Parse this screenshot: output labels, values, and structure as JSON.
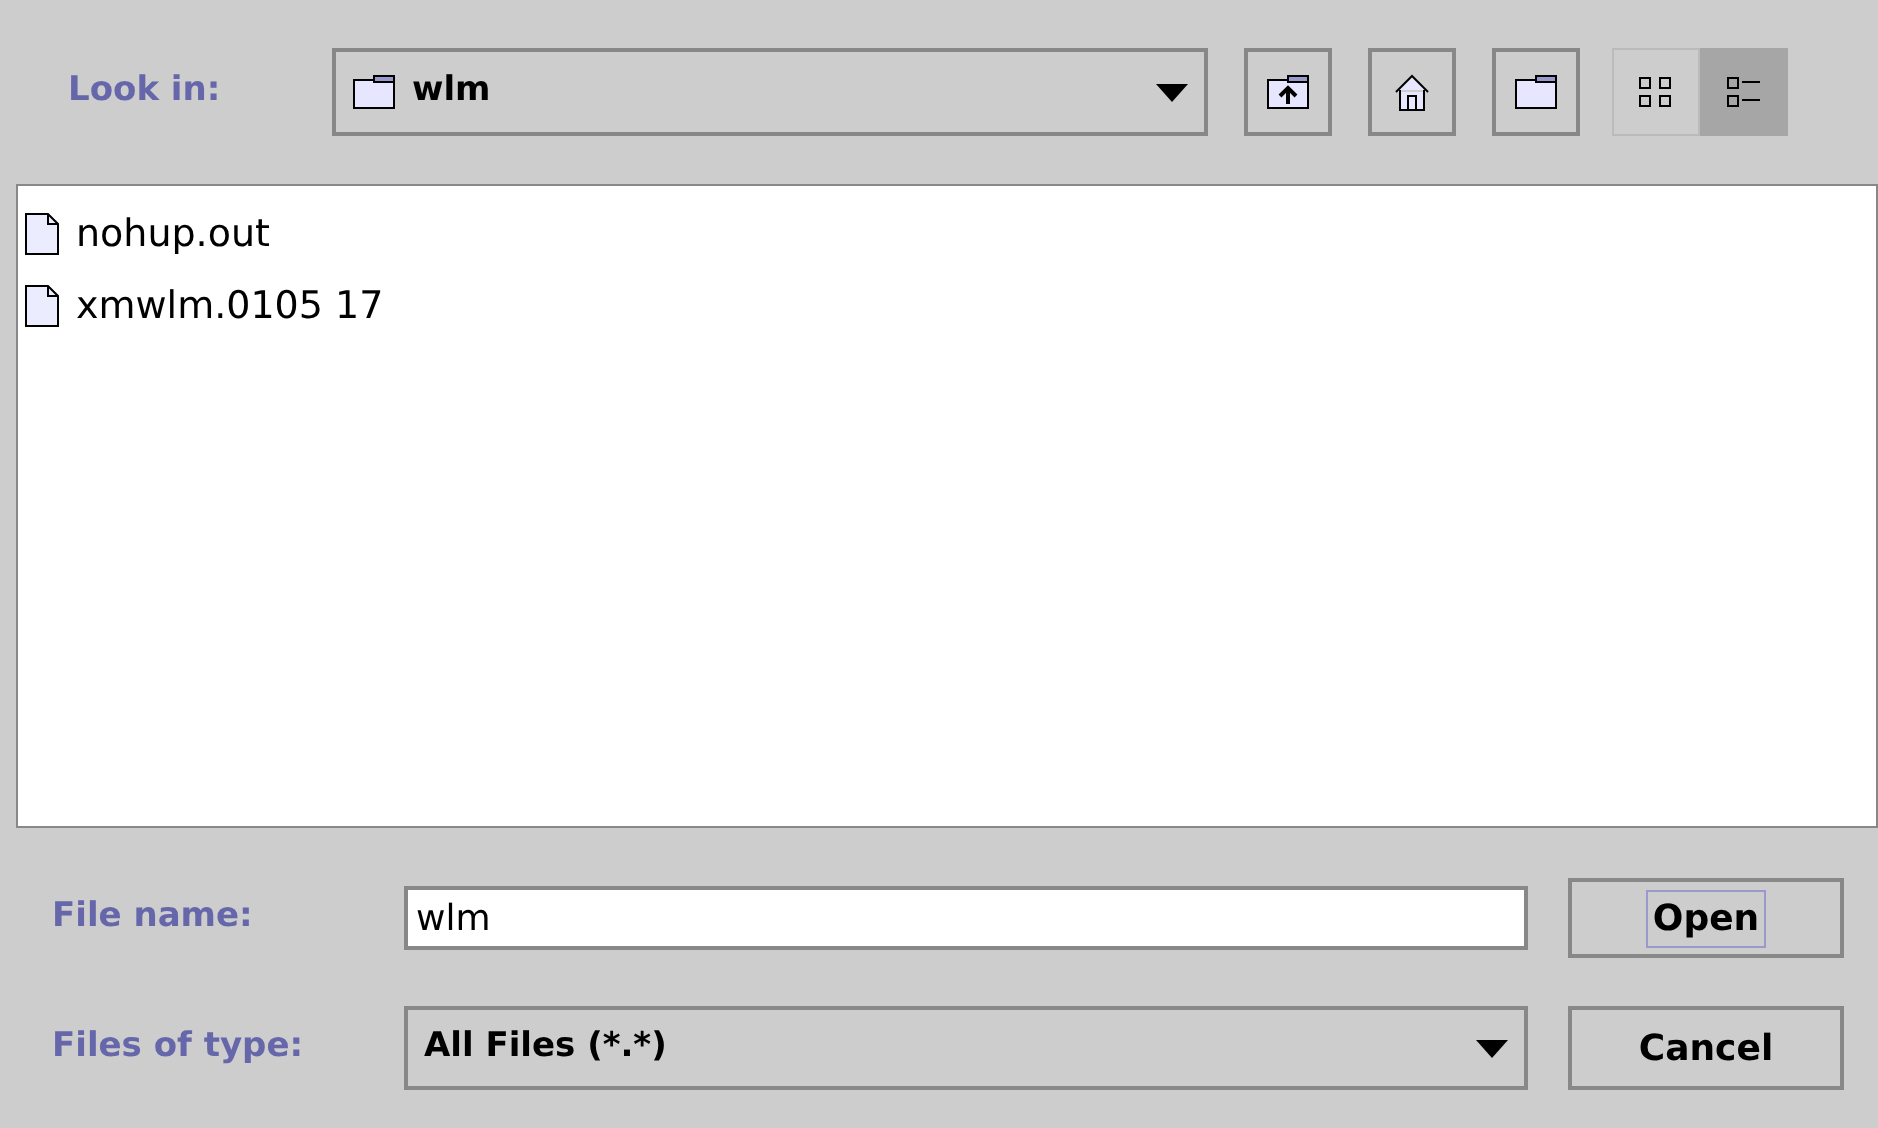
{
  "look_in": {
    "label": "Look in:",
    "value": "wlm"
  },
  "toolbar": [
    {
      "kind": "up"
    },
    {
      "kind": "home"
    },
    {
      "kind": "new-folder"
    }
  ],
  "views": [
    {
      "kind": "list",
      "selected": false
    },
    {
      "kind": "details",
      "selected": true
    }
  ],
  "files": [
    {
      "name": "nohup.out"
    },
    {
      "name": "xmwlm.0105 17"
    }
  ],
  "file_name": {
    "label": "File name:",
    "value": "wlm"
  },
  "file_type": {
    "label": "Files of type:",
    "value": "All Files (*.*)"
  },
  "buttons": [
    {
      "label": "Open",
      "focused": true
    },
    {
      "label": "Cancel",
      "focused": false
    }
  ]
}
